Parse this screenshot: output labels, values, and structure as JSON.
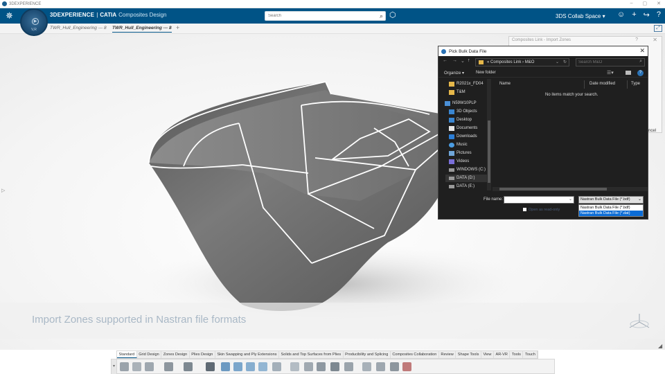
{
  "os": {
    "title": "3DEXPERIENCE",
    "controls": [
      "–",
      "▢",
      "✕"
    ]
  },
  "header": {
    "brand": "3DEXPERIENCE",
    "brand_product": "CATIA",
    "brand_app": "Composites Design",
    "search_placeholder": "Search",
    "collab_space": "3DS Collab Space ▾"
  },
  "compass": {
    "label": "V,R"
  },
  "tabs": [
    {
      "label": "TWR_Hull_Engineering --- 8"
    },
    {
      "label": "TWR_Hull_Engineering --- 8"
    }
  ],
  "tab_add": "+",
  "viewport": {
    "caption": "Import Zones supported in Nastran file formats"
  },
  "import_dialog": {
    "title": "Composites Link - Import Zones",
    "help": "?",
    "close": "✕",
    "cancel_fragment": "ncel"
  },
  "file_dialog": {
    "title": "Pick Bulk Data File",
    "close": "✕",
    "address": {
      "parts": "«  Composites Link  ›  M&O"
    },
    "search_placeholder": "Search M&O",
    "toolbar": {
      "organize": "Organize ▾",
      "new_folder": "New folder"
    },
    "nav_items": [
      {
        "label": "R2021x_FD04",
        "icon": "folder"
      },
      {
        "label": "T&M",
        "icon": "folder"
      },
      {
        "label": "N59W10PLP",
        "icon": "pc"
      },
      {
        "label": "3D Objects",
        "icon": "blue"
      },
      {
        "label": "Desktop",
        "icon": "blue"
      },
      {
        "label": "Documents",
        "icon": "doc"
      },
      {
        "label": "Downloads",
        "icon": "dl"
      },
      {
        "label": "Music",
        "icon": "music"
      },
      {
        "label": "Pictures",
        "icon": "pic"
      },
      {
        "label": "Videos",
        "icon": "vid"
      },
      {
        "label": "WINDOWS (C:)",
        "icon": "drive"
      },
      {
        "label": "DATA (D:)",
        "icon": "drive"
      },
      {
        "label": "DATA (E:)",
        "icon": "drive"
      }
    ],
    "columns": {
      "name": "Name",
      "date": "Date modified",
      "type": "Type"
    },
    "empty_message": "No items match your search.",
    "file_name_label": "File name:",
    "file_name_value": "",
    "filter_selected": "Nastran Bulk Data File (*.bdf)",
    "filter_options": [
      "Nastran Bulk Data File (*.bdf)",
      "Nastran Bulk Data File (*.dat)"
    ],
    "readonly_label": "Open as read-only"
  },
  "bottom_tabs": [
    "Standard",
    "Grid Design",
    "Zones Design",
    "Plies Design",
    "Skin Swapping and Ply Extensions",
    "Solids and Top Surfaces from Plies",
    "Producibility and Splicing",
    "Composites Collaboration",
    "Review",
    "Shape Tools",
    "View",
    "AR-VR",
    "Tools",
    "Touch"
  ],
  "colors": {
    "header": "#005386",
    "dialog": "#1f1f1f",
    "selection": "#0b6cd6",
    "hull": "#6c6c6c"
  }
}
